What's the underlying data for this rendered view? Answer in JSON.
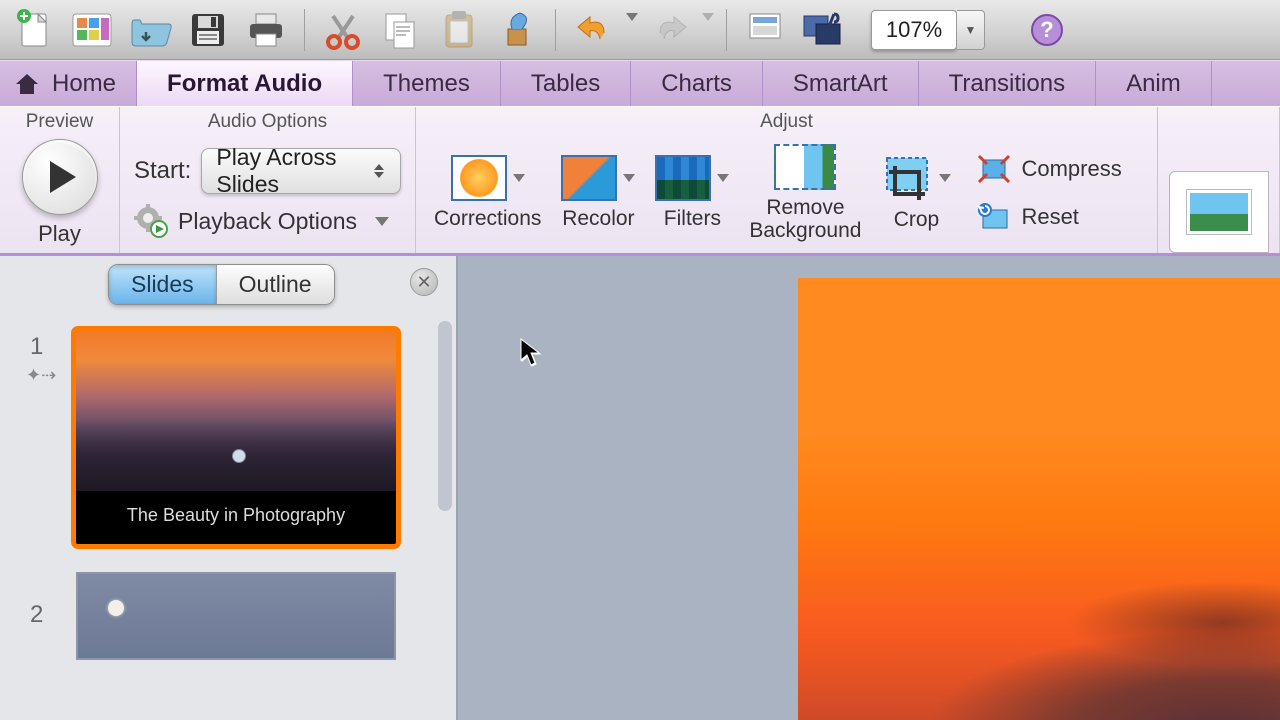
{
  "toolbar": {
    "zoom": "107%"
  },
  "tabs": {
    "home": "Home",
    "format_audio": "Format Audio",
    "themes": "Themes",
    "tables": "Tables",
    "charts": "Charts",
    "smartart": "SmartArt",
    "transitions": "Transitions",
    "animations": "Anim"
  },
  "groups": {
    "preview": {
      "title": "Preview",
      "play": "Play"
    },
    "audio_options": {
      "title": "Audio Options",
      "start_label": "Start:",
      "start_value": "Play Across Slides",
      "playback": "Playback Options"
    },
    "adjust": {
      "title": "Adjust",
      "corrections": "Corrections",
      "recolor": "Recolor",
      "filters": "Filters",
      "remove_background": "Remove\nBackground",
      "crop": "Crop",
      "compress": "Compress",
      "reset": "Reset"
    }
  },
  "panel": {
    "slides_tab": "Slides",
    "outline_tab": "Outline",
    "slide1_num": "1",
    "slide1_title": "The Beauty in Photography",
    "slide2_num": "2"
  }
}
